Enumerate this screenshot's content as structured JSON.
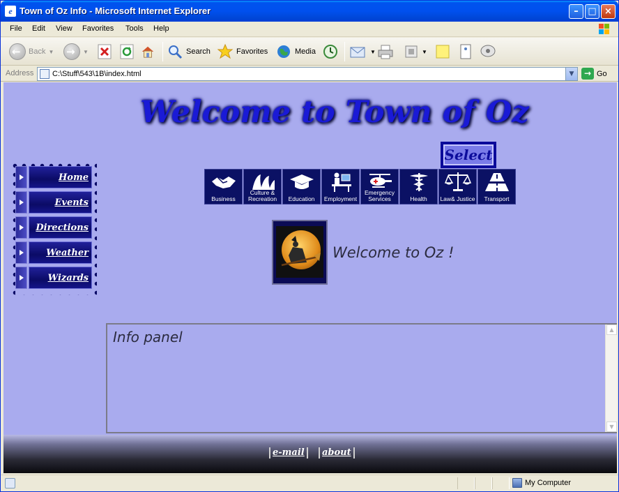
{
  "window": {
    "title": "Town of Oz Info - Microsoft Internet Explorer"
  },
  "menu": [
    "File",
    "Edit",
    "View",
    "Favorites",
    "Tools",
    "Help"
  ],
  "toolbar": {
    "back": "Back",
    "search": "Search",
    "favorites": "Favorites",
    "media": "Media"
  },
  "address": {
    "label": "Address",
    "url": "C:\\Stuff\\543\\1B\\index.html",
    "go": "Go"
  },
  "page": {
    "title": "Welcome to Town of Oz",
    "select_label": "Select",
    "categories": [
      {
        "label": "Business",
        "icon": "handshake-icon"
      },
      {
        "label": "Culture & Recreation",
        "icon": "opera-house-icon"
      },
      {
        "label": "Education",
        "icon": "graduation-cap-icon"
      },
      {
        "label": "Employment",
        "icon": "desk-worker-icon"
      },
      {
        "label": "Emergency Services",
        "icon": "helicopter-icon"
      },
      {
        "label": "Health",
        "icon": "caduceus-icon"
      },
      {
        "label": "Law& Justice",
        "icon": "scales-icon"
      },
      {
        "label": "Transport",
        "icon": "road-icon"
      }
    ],
    "nav": [
      "Home",
      "Events",
      "Directions",
      "Weather",
      "Wizards"
    ],
    "welcome": "Welcome to Oz !",
    "info_title": "Info panel",
    "footer_links": [
      "e-mail",
      "about"
    ]
  },
  "status": {
    "zone": "My Computer"
  },
  "colors": {
    "page_bg": "#a9abee",
    "title_blue": "#1a1ad6",
    "nav_dark": "#0b0b66"
  }
}
